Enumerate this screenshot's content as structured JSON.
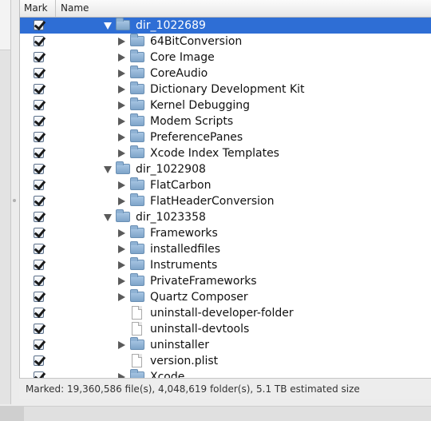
{
  "header": {
    "mark_label": "Mark",
    "name_label": "Name"
  },
  "rows": [
    {
      "name": "dir_1022689",
      "type": "folder",
      "depth": 0,
      "expanded": true,
      "selected": true
    },
    {
      "name": "64BitConversion",
      "type": "folder",
      "depth": 1,
      "expanded": false
    },
    {
      "name": "Core Image",
      "type": "folder",
      "depth": 1,
      "expanded": false
    },
    {
      "name": "CoreAudio",
      "type": "folder",
      "depth": 1,
      "expanded": false
    },
    {
      "name": "Dictionary Development Kit",
      "type": "folder",
      "depth": 1,
      "expanded": false
    },
    {
      "name": "Kernel Debugging",
      "type": "folder",
      "depth": 1,
      "expanded": false
    },
    {
      "name": "Modem Scripts",
      "type": "folder",
      "depth": 1,
      "expanded": false
    },
    {
      "name": "PreferencePanes",
      "type": "folder",
      "depth": 1,
      "expanded": false
    },
    {
      "name": "Xcode Index Templates",
      "type": "folder",
      "depth": 1,
      "expanded": false
    },
    {
      "name": "dir_1022908",
      "type": "folder",
      "depth": 0,
      "expanded": true
    },
    {
      "name": "FlatCarbon",
      "type": "folder",
      "depth": 1,
      "expanded": false
    },
    {
      "name": "FlatHeaderConversion",
      "type": "folder",
      "depth": 1,
      "expanded": false
    },
    {
      "name": "dir_1023358",
      "type": "folder",
      "depth": 0,
      "expanded": true
    },
    {
      "name": "Frameworks",
      "type": "folder",
      "depth": 1,
      "expanded": false
    },
    {
      "name": "installedfiles",
      "type": "folder",
      "depth": 1,
      "expanded": false
    },
    {
      "name": "Instruments",
      "type": "folder",
      "depth": 1,
      "expanded": false
    },
    {
      "name": "PrivateFrameworks",
      "type": "folder",
      "depth": 1,
      "expanded": false
    },
    {
      "name": "Quartz Composer",
      "type": "folder",
      "depth": 1,
      "expanded": false
    },
    {
      "name": "uninstall-developer-folder",
      "type": "file",
      "depth": 1
    },
    {
      "name": "uninstall-devtools",
      "type": "file",
      "depth": 1
    },
    {
      "name": "uninstaller",
      "type": "folder",
      "depth": 1,
      "expanded": false
    },
    {
      "name": "version.plist",
      "type": "file",
      "depth": 1
    },
    {
      "name": "Xcode",
      "type": "folder",
      "depth": 1,
      "expanded": false
    }
  ],
  "status": {
    "text": "Marked: 19,360,586 file(s), 4,048,619 folder(s), 5.1 TB estimated size"
  },
  "colors": {
    "selection": "#2e6ed5"
  },
  "icons": {
    "folder": "folder-icon",
    "file": "file-icon",
    "check": "checkbox-checked",
    "expanded": "disclosure-open-icon",
    "collapsed": "disclosure-closed-icon"
  }
}
